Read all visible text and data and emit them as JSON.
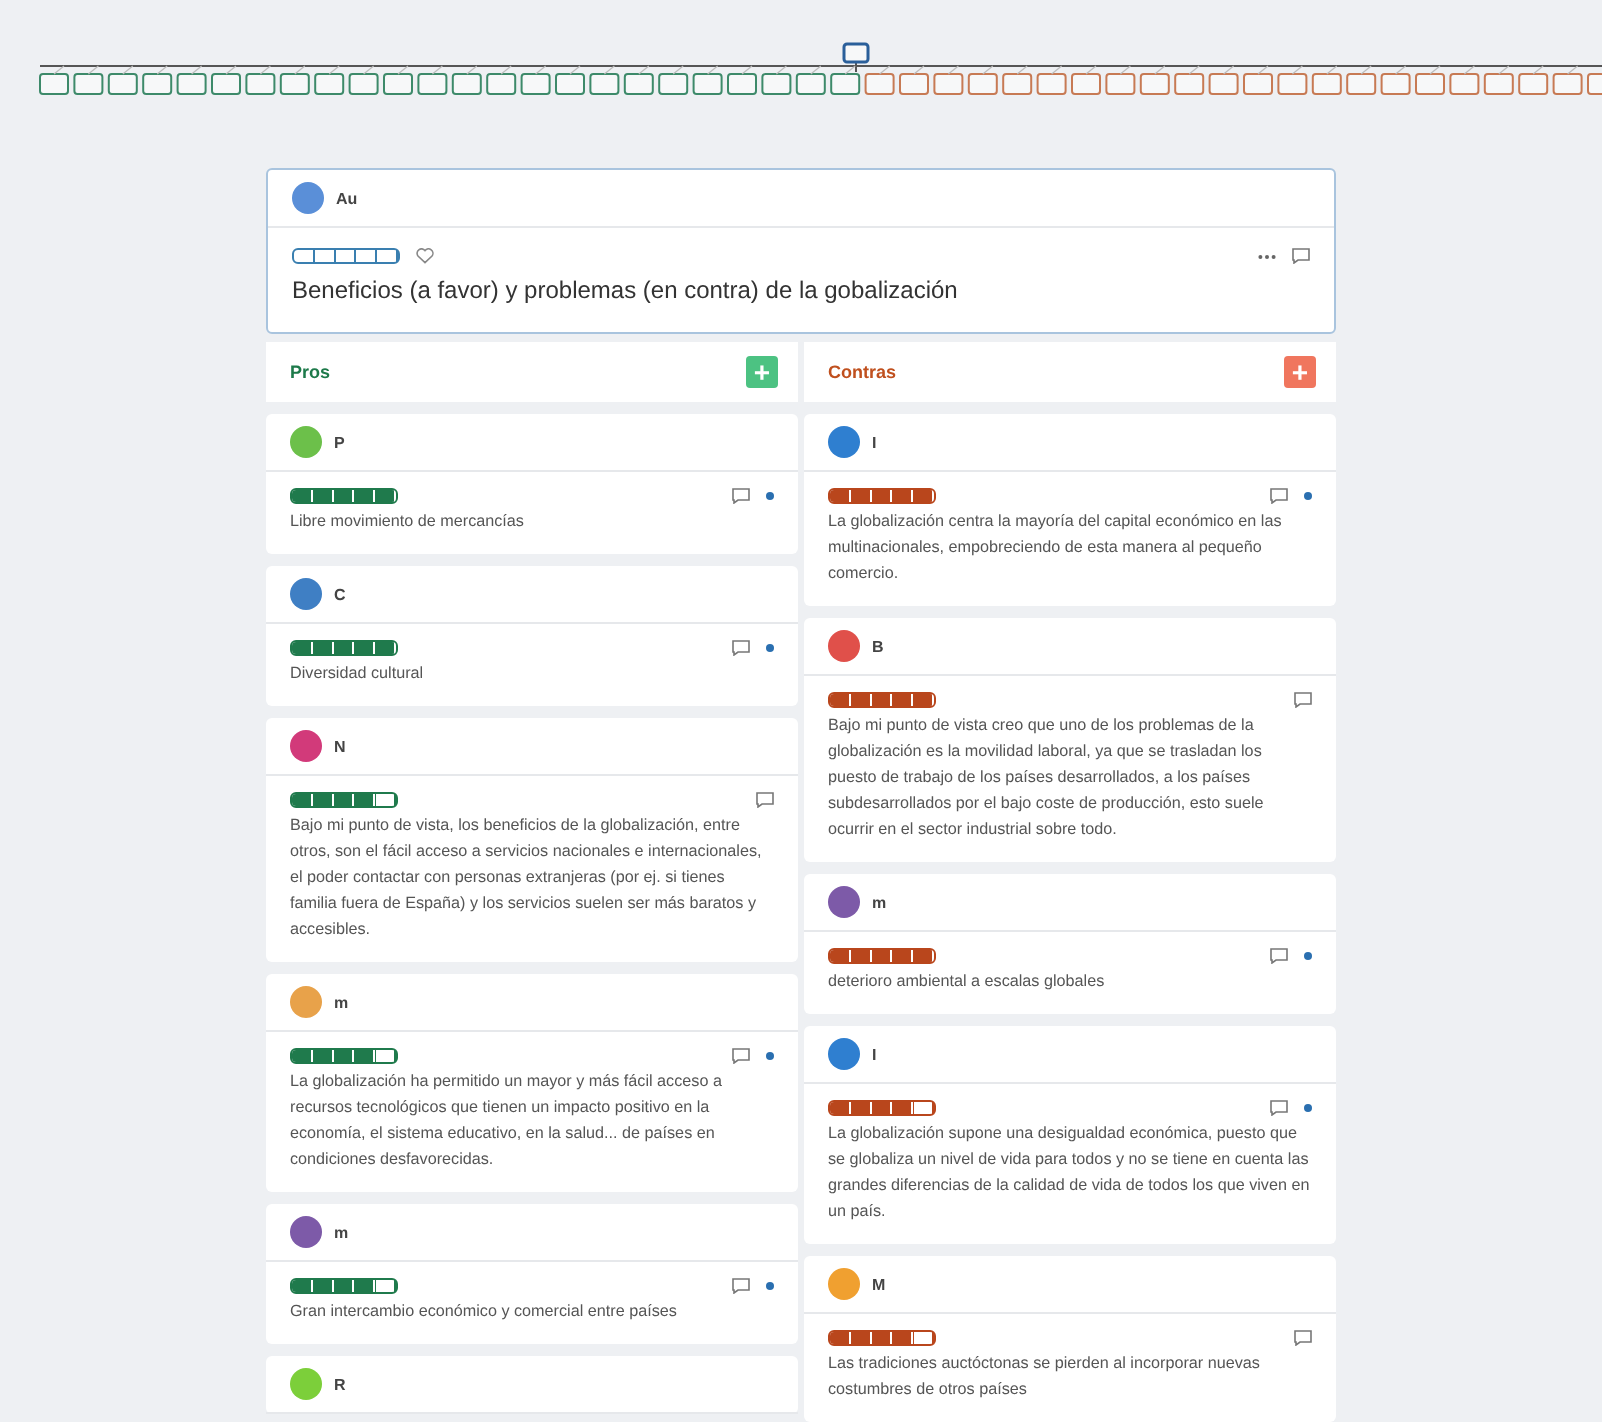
{
  "topic": {
    "author": "Au",
    "rating": {
      "level": 0
    },
    "liked": false,
    "title": "Beneficios (a favor) y problemas (en contra) de la gobalización"
  },
  "columns": [
    {
      "kind": "pro",
      "title": "Pros",
      "add_label": "+",
      "cards": [
        {
          "author": "P",
          "color": "#6cc04a",
          "level": 1,
          "unread": true,
          "text": "Libre movimiento de mercancías"
        },
        {
          "author": "C",
          "color": "#3f7fc4",
          "level": 1,
          "unread": true,
          "text": "Diversidad cultural"
        },
        {
          "author": "N",
          "color": "#d23a7a",
          "level": 0.8,
          "unread": false,
          "text": "Bajo mi punto de vista, los beneficios de la globalización, entre otros, son el fácil acceso a servicios nacionales e internacionales, el poder contactar con personas extranjeras (por ej. si tienes familia fuera de España) y los servicios suelen ser más baratos y accesibles."
        },
        {
          "author": "m",
          "color": "#e8a24a",
          "level": 0.8,
          "unread": true,
          "text": "La globalización ha permitido un mayor y más fácil acceso a recursos tecnológicos que tienen un impacto positivo en la economía, el sistema educativo, en la salud... de países en condiciones desfavorecidas."
        },
        {
          "author": "m",
          "color": "#7d5aa8",
          "level": 0.8,
          "unread": true,
          "text": "Gran intercambio económico y comercial entre países"
        },
        {
          "author": "R",
          "color": "#7ccf3a"
        }
      ]
    },
    {
      "kind": "con",
      "title": "Contras",
      "add_label": "+",
      "cards": [
        {
          "author": "I",
          "color": "#2f7fd0",
          "level": 1,
          "unread": true,
          "text": "La globalización centra la mayoría del capital económico en las multinacionales, empobreciendo de esta manera al pequeño comercio."
        },
        {
          "author": "B",
          "color": "#e0504a",
          "level": 1,
          "unread": false,
          "text": "Bajo mi punto de vista creo que uno de los problemas de la globalización es la movilidad laboral, ya que se trasladan los puesto de trabajo de los países desarrollados, a los países subdesarrollados por el bajo coste de producción, esto suele ocurrir en el sector industrial sobre todo."
        },
        {
          "author": "m",
          "color": "#7d5aa8",
          "level": 1,
          "unread": true,
          "text": "deterioro ambiental a escalas globales"
        },
        {
          "author": "I",
          "color": "#2f7fd0",
          "level": 0.8,
          "unread": true,
          "text": "La globalización supone una desigualdad económica, puesto que se globaliza un nivel de vida para todos y no se tiene en cuenta las grandes diferencias de la calidad de vida de todos los que viven en un país."
        },
        {
          "author": "M",
          "color": "#f0a030",
          "level": 0.8,
          "unread": false,
          "text": "Las tradiciones auctóctonas se pierden al incorporar nuevas costumbres de otros países"
        }
      ]
    }
  ]
}
